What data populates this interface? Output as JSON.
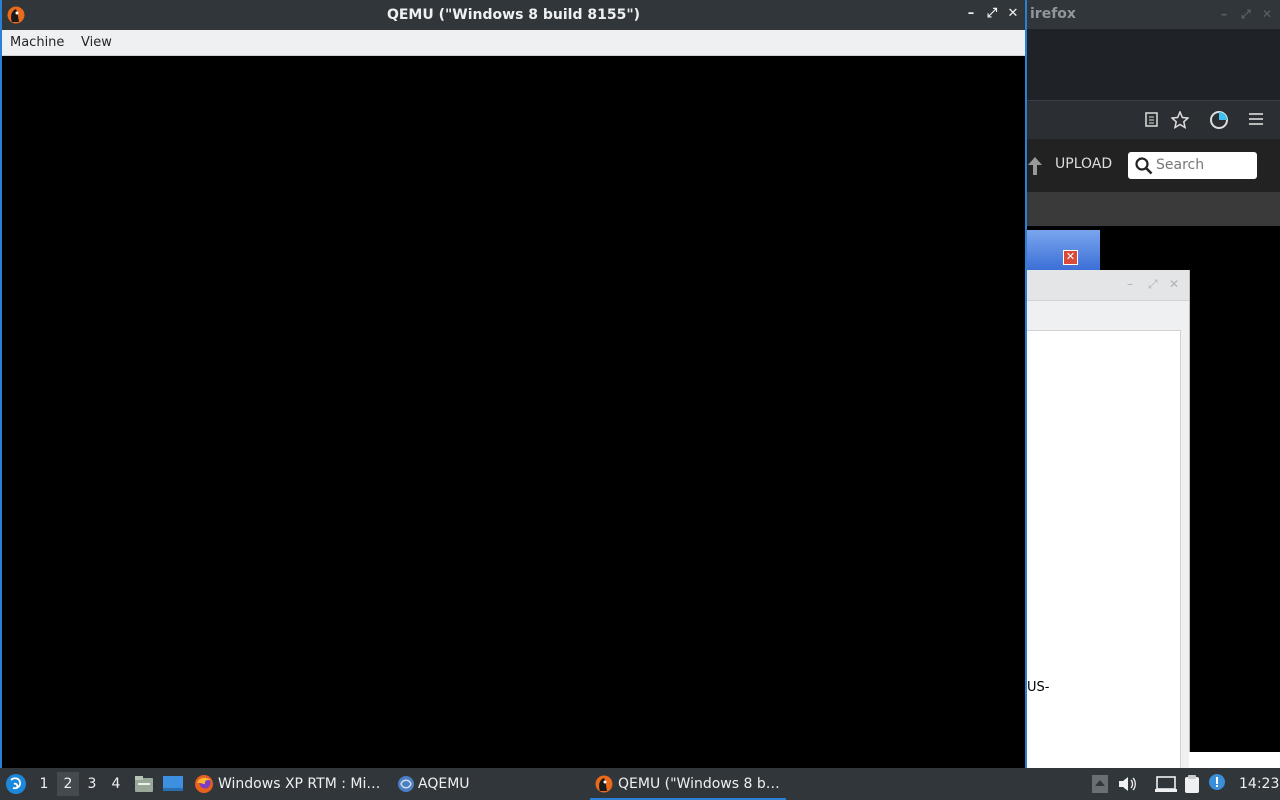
{
  "background_window": {
    "title_fragment": "irefox",
    "site": {
      "upload_label": "UPLOAD",
      "search_placeholder": "Search"
    },
    "dialog_fragment": "US-"
  },
  "qemu_window": {
    "title": "QEMU (\"Windows 8 build 8155\")",
    "menu": [
      "Machine",
      "View"
    ],
    "buttons": {
      "minimize": "–",
      "maximize": "⤢",
      "close": "✕"
    }
  },
  "taskbar": {
    "desktops": [
      "1",
      "2",
      "3",
      "4"
    ],
    "active_desktop": "2",
    "tasks": [
      {
        "label": "Windows XP RTM : Mi…",
        "icon": "firefox-icon"
      },
      {
        "label": "AQEMU",
        "icon": "aqemu-icon"
      },
      {
        "label": "QEMU (\"Windows 8 b…",
        "icon": "qemu-icon"
      }
    ],
    "clock": "14:23"
  },
  "colors": {
    "accent": "#2a80d4",
    "titlebar": "#31363b",
    "menubar": "#eff0f1"
  }
}
